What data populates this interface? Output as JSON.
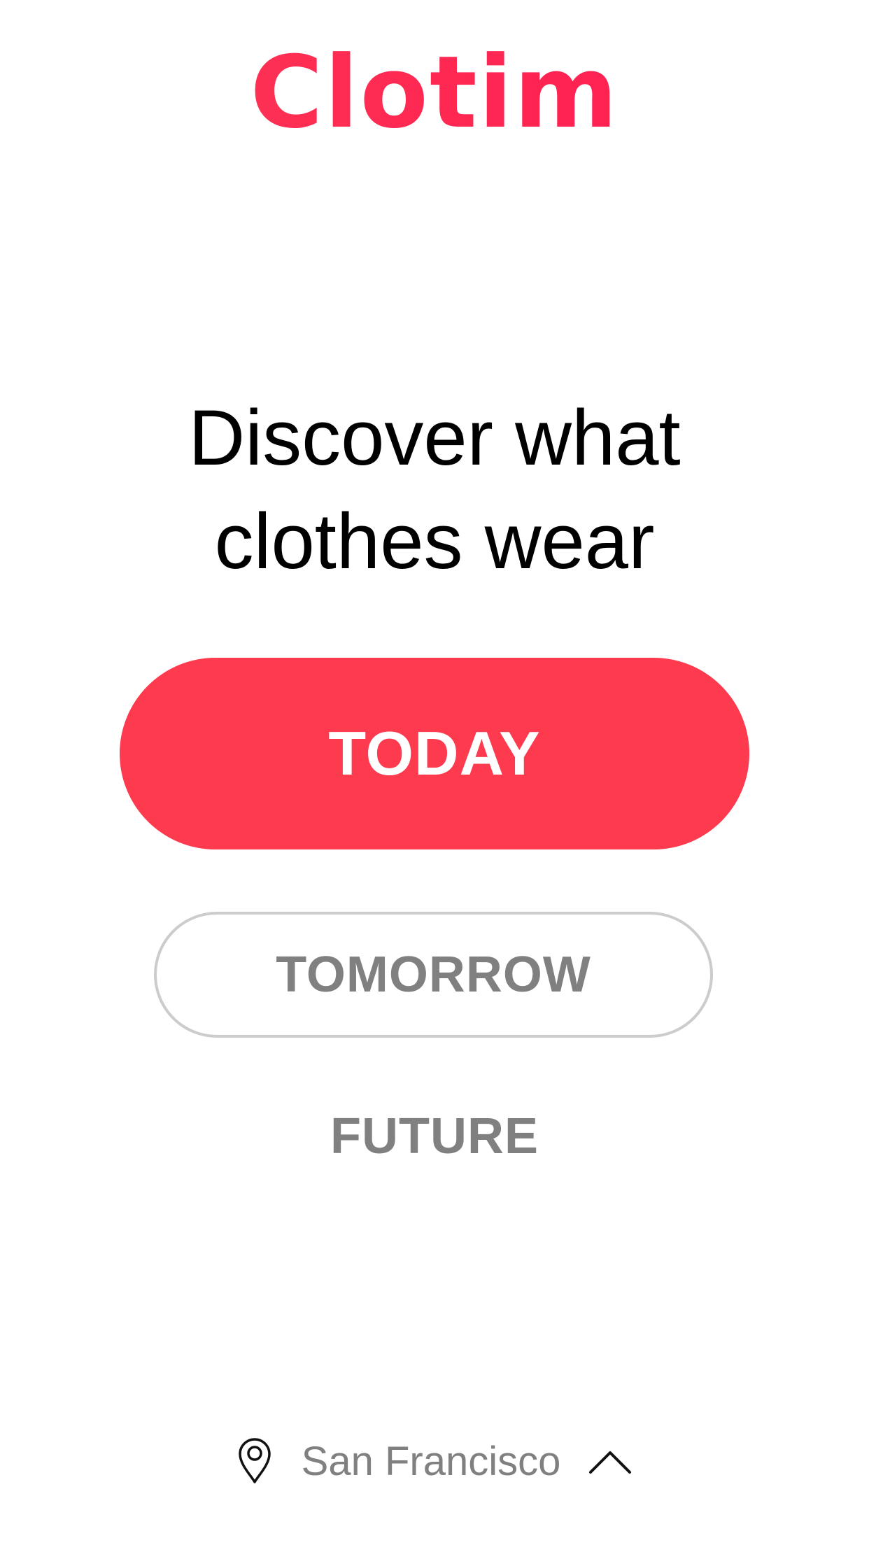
{
  "app": {
    "logo_text": "Clotim",
    "brand_color": "#fe2258"
  },
  "hero": {
    "line1": "Discover what",
    "line2": "clothes wear"
  },
  "actions": {
    "today_label": "TODAY",
    "tomorrow_label": "TOMORROW",
    "future_label": "FUTURE",
    "primary_color": "#fe3a4e",
    "secondary_text_color": "#808080"
  },
  "location": {
    "city": "San Francisco",
    "pin_icon": "location-pin-icon",
    "toggle_icon": "chevron-up-icon"
  }
}
